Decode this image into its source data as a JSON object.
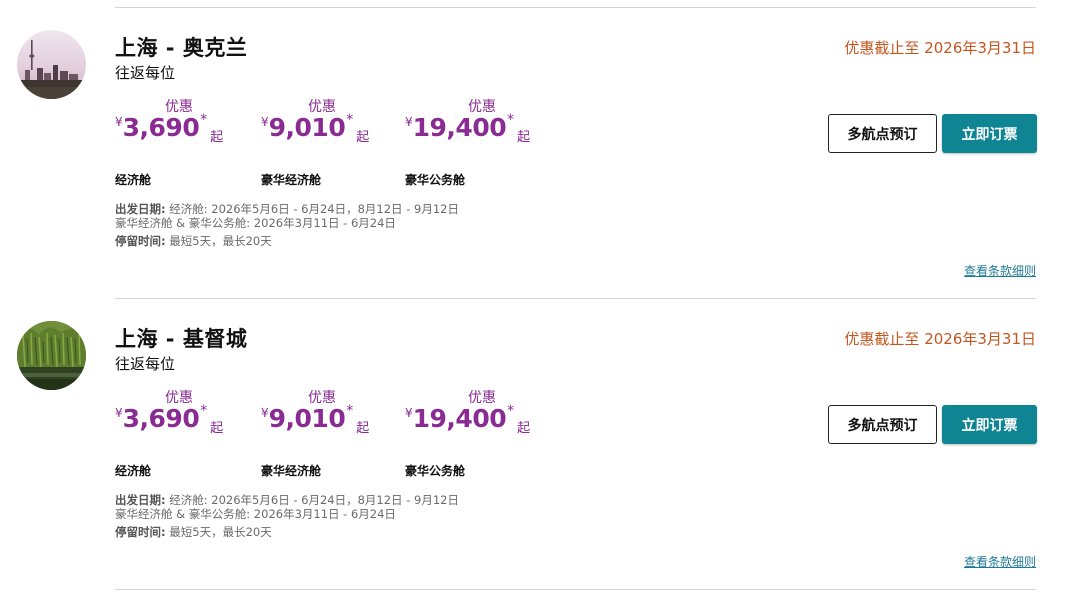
{
  "offers": [
    {
      "route": "上海 - 奥克兰",
      "subtitle": "往返每位",
      "deadline": "优惠截止至 2026年3月31日",
      "avatar_icon": "auckland-skyline-photo",
      "fares": [
        {
          "promo": "优惠",
          "currency": "¥",
          "price": "3,690",
          "star": "*",
          "from": "起",
          "cabin": "经济舱"
        },
        {
          "promo": "优惠",
          "currency": "¥",
          "price": "9,010",
          "star": "*",
          "from": "起",
          "cabin": "豪华经济舱"
        },
        {
          "promo": "优惠",
          "currency": "¥",
          "price": "19,400",
          "star": "*",
          "from": "起",
          "cabin": "豪华公务舱"
        }
      ],
      "multi_city_label": "多航点预订",
      "book_label": "立即订票",
      "travel_dates_label": "出发日期:",
      "travel_dates_line1": " 经济舱: 2026年5月6日 - 6月24日，8月12日 - 9月12日",
      "travel_dates_line2": "豪华经济舱 & 豪华公务舱: 2026年3月11日 - 6月24日",
      "stay_label": "停留时间:",
      "stay_value": " 最短5天，最长20天",
      "terms_label": "查看条款细则"
    },
    {
      "route": "上海 - 基督城",
      "subtitle": "往返每位",
      "deadline": "优惠截止至 2026年3月31日",
      "avatar_icon": "christchurch-willow-river-photo",
      "fares": [
        {
          "promo": "优惠",
          "currency": "¥",
          "price": "3,690",
          "star": "*",
          "from": "起",
          "cabin": "经济舱"
        },
        {
          "promo": "优惠",
          "currency": "¥",
          "price": "9,010",
          "star": "*",
          "from": "起",
          "cabin": "豪华经济舱"
        },
        {
          "promo": "优惠",
          "currency": "¥",
          "price": "19,400",
          "star": "*",
          "from": "起",
          "cabin": "豪华公务舱"
        }
      ],
      "multi_city_label": "多航点预订",
      "book_label": "立即订票",
      "travel_dates_label": "出发日期:",
      "travel_dates_line1": " 经济舱: 2026年5月6日 - 6月24日，8月12日 - 9月12日",
      "travel_dates_line2": "豪华经济舱 & 豪华公务舱: 2026年3月11日 - 6月24日",
      "stay_label": "停留时间:",
      "stay_value": " 最短5天，最长20天",
      "terms_label": "查看条款细则"
    }
  ],
  "colors": {
    "price_purple": "#8a2a93",
    "deadline_orange": "#c4561f",
    "book_teal": "#0f8492",
    "link_blue": "#1f7a96"
  }
}
